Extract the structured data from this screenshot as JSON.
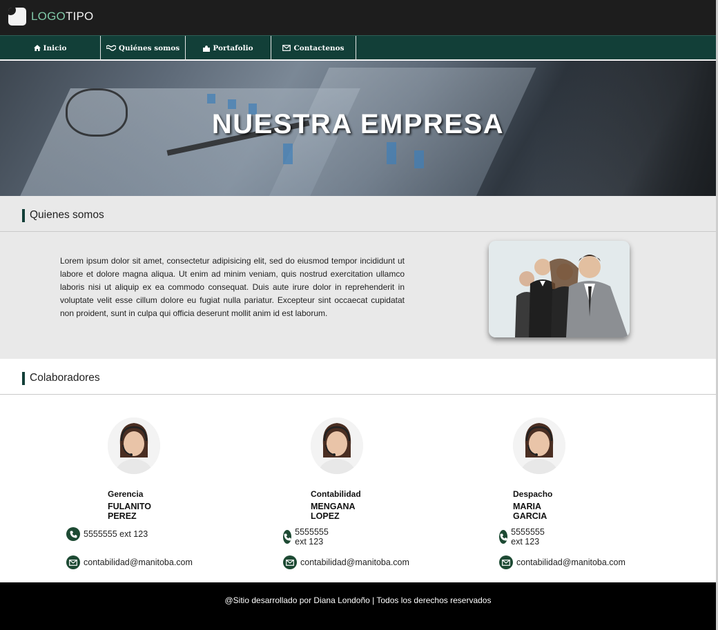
{
  "header": {
    "logo_part1": "LOGO",
    "logo_part2": "TIPO"
  },
  "nav": {
    "items": [
      {
        "label": "Inicio",
        "icon": "home-icon"
      },
      {
        "label": "Quiénes somos",
        "icon": "handshake-icon"
      },
      {
        "label": "Portafolio",
        "icon": "puzzle-icon"
      },
      {
        "label": "Contactenos",
        "icon": "envelope-icon"
      }
    ]
  },
  "hero": {
    "title": "NUESTRA EMPRESA"
  },
  "about": {
    "title": "Quienes somos",
    "text": "Lorem ipsum dolor sit amet, consectetur adipisicing elit, sed do eiusmod tempor incididunt ut labore et dolore magna aliqua. Ut enim ad minim veniam, quis nostrud exercitation ullamco laboris nisi ut aliquip ex ea commodo consequat. Duis aute irure dolor in reprehenderit in voluptate velit esse cillum dolore eu fugiat nulla pariatur. Excepteur sint occaecat cupidatat non proident, sunt in culpa qui officia deserunt mollit anim id est laborum."
  },
  "collaborators": {
    "title": "Colaboradores",
    "people": [
      {
        "role": "Gerencia",
        "name": "FULANITO PEREZ",
        "phone": "5555555 ext 123",
        "email": "contabilidad@manitoba.com"
      },
      {
        "role": "Contabilidad",
        "name": "MENGANA LOPEZ",
        "phone": "5555555 ext 123",
        "email": "contabilidad@manitoba.com"
      },
      {
        "role": "Despacho",
        "name": "MARIA GARCIA",
        "phone": "5555555 ext 123",
        "email": "contabilidad@manitoba.com"
      }
    ]
  },
  "footer": {
    "text": "@Sitio desarrollado por Diana Londoño | Todos los derechos reservados"
  },
  "colors": {
    "nav_bg": "#123f38",
    "header_bg": "#1d1d1d",
    "logo_accent": "#7fc8a7",
    "contact_icon_bg": "#1d4a33",
    "footer_bg": "#000000"
  }
}
